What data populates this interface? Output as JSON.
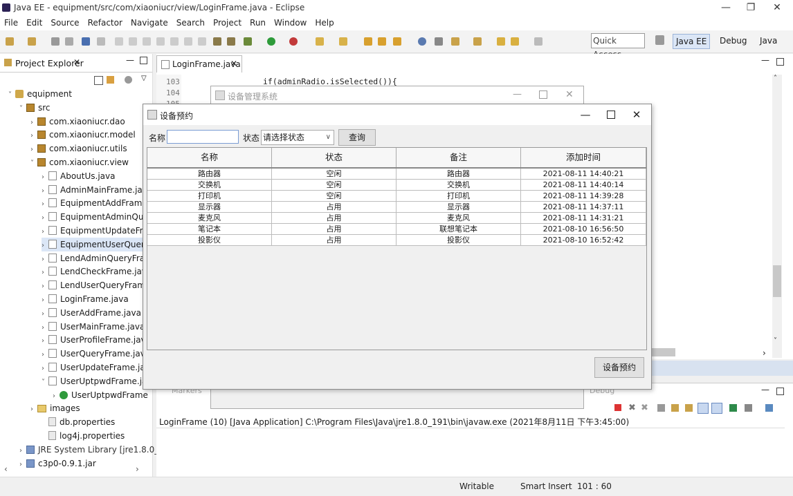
{
  "window": {
    "title": "Java EE - equipment/src/com/xiaoniucr/view/LoginFrame.java - Eclipse",
    "min": "—",
    "restore": "❐",
    "close": "✕"
  },
  "menu": [
    "File",
    "Edit",
    "Source",
    "Refactor",
    "Navigate",
    "Search",
    "Project",
    "Run",
    "Window",
    "Help"
  ],
  "toolbar": {
    "quick_access": "Quick Access",
    "perspectives": [
      "Java EE",
      "Debug",
      "Java"
    ]
  },
  "explorer": {
    "title": "Project Explorer",
    "items": [
      {
        "label": "equipment",
        "icon": "project-icon",
        "twisty": "˅"
      },
      {
        "label": "src",
        "icon": "source-folder-icon",
        "twisty": "˅"
      },
      {
        "label": "com.xiaoniucr.dao",
        "icon": "package-icon",
        "twisty": "›"
      },
      {
        "label": "com.xiaoniucr.model",
        "icon": "package-icon",
        "twisty": "›"
      },
      {
        "label": "com.xiaoniucr.utils",
        "icon": "package-icon",
        "twisty": "›"
      },
      {
        "label": "com.xiaoniucr.view",
        "icon": "package-icon",
        "twisty": "˅"
      },
      {
        "label": "AboutUs.java",
        "icon": "java-file-icon",
        "twisty": "›"
      },
      {
        "label": "AdminMainFrame.java",
        "icon": "java-file-icon",
        "twisty": "›"
      },
      {
        "label": "EquipmentAddFrame.java",
        "icon": "java-file-icon",
        "twisty": "›"
      },
      {
        "label": "EquipmentAdminQueryF",
        "icon": "java-file-icon",
        "twisty": "›"
      },
      {
        "label": "EquipmentUpdateFrame",
        "icon": "java-file-icon",
        "twisty": "›"
      },
      {
        "label": "EquipmentUserQueryFra",
        "icon": "java-file-icon",
        "twisty": "›"
      },
      {
        "label": "LendAdminQueryFrame.",
        "icon": "java-file-icon",
        "twisty": "›"
      },
      {
        "label": "LendCheckFrame.java",
        "icon": "java-file-icon",
        "twisty": "›"
      },
      {
        "label": "LendUserQueryFrame.ja",
        "icon": "java-file-icon",
        "twisty": "›"
      },
      {
        "label": "LoginFrame.java",
        "icon": "java-file-icon",
        "twisty": "›"
      },
      {
        "label": "UserAddFrame.java",
        "icon": "java-file-icon",
        "twisty": "›"
      },
      {
        "label": "UserMainFrame.java",
        "icon": "java-file-icon",
        "twisty": "›"
      },
      {
        "label": "UserProfileFrame.java",
        "icon": "java-file-icon",
        "twisty": "›"
      },
      {
        "label": "UserQueryFrame.java",
        "icon": "java-file-icon",
        "twisty": "›"
      },
      {
        "label": "UserUpdateFrame.java",
        "icon": "java-file-icon",
        "twisty": "›"
      },
      {
        "label": "UserUptpwdFrame.java",
        "icon": "java-file-icon",
        "twisty": "˅"
      },
      {
        "label": "UserUptpwdFrame",
        "icon": "class-icon",
        "twisty": "›"
      },
      {
        "label": "images",
        "icon": "folder-icon",
        "twisty": "›"
      },
      {
        "label": "db.properties",
        "icon": "file-icon",
        "twisty": ""
      },
      {
        "label": "log4j.properties",
        "icon": "file-icon",
        "twisty": ""
      },
      {
        "label": "JRE System Library [jre1.8.0_19",
        "icon": "library-icon",
        "twisty": "›"
      },
      {
        "label": "c3p0-0.9.1.jar",
        "icon": "jar-icon",
        "twisty": "›"
      }
    ]
  },
  "editor": {
    "tab": "LoginFrame.java",
    "lines": [
      "103",
      "104",
      "105"
    ],
    "code_line": "if(adminRadio.isSelected()){"
  },
  "console": {
    "tabs": [
      "Markers",
      "Debug"
    ],
    "launch": "LoginFrame (10) [Java Application] C:\\Program Files\\Java\\jre1.8.0_191\\bin\\javaw.exe (2021年8月11日 下午3:45:00)"
  },
  "status": {
    "writable": "Writable",
    "insert": "Smart Insert",
    "position": "101 : 60"
  },
  "bg_dialog": {
    "title": "设备管理系统"
  },
  "dialog": {
    "title": "设备预约",
    "name_label": "名称",
    "name_value": "",
    "status_label": "状态",
    "status_value": "请选择状态",
    "query_button": "查询",
    "reserve_button": "设备预约",
    "columns": [
      "名称",
      "状态",
      "备注",
      "添加时间"
    ],
    "rows": [
      [
        "路由器",
        "空闲",
        "路由器",
        "2021-08-11 14:40:21"
      ],
      [
        "交换机",
        "空闲",
        "交换机",
        "2021-08-11 14:40:14"
      ],
      [
        "打印机",
        "空闲",
        "打印机",
        "2021-08-11 14:39:28"
      ],
      [
        "显示器",
        "占用",
        "显示器",
        "2021-08-11 14:37:11"
      ],
      [
        "麦克风",
        "占用",
        "麦克风",
        "2021-08-11 14:31:21"
      ],
      [
        "笔记本",
        "占用",
        "联想笔记本",
        "2021-08-10 16:56:50"
      ],
      [
        "投影仪",
        "占用",
        "投影仪",
        "2021-08-10 16:52:42"
      ]
    ]
  }
}
